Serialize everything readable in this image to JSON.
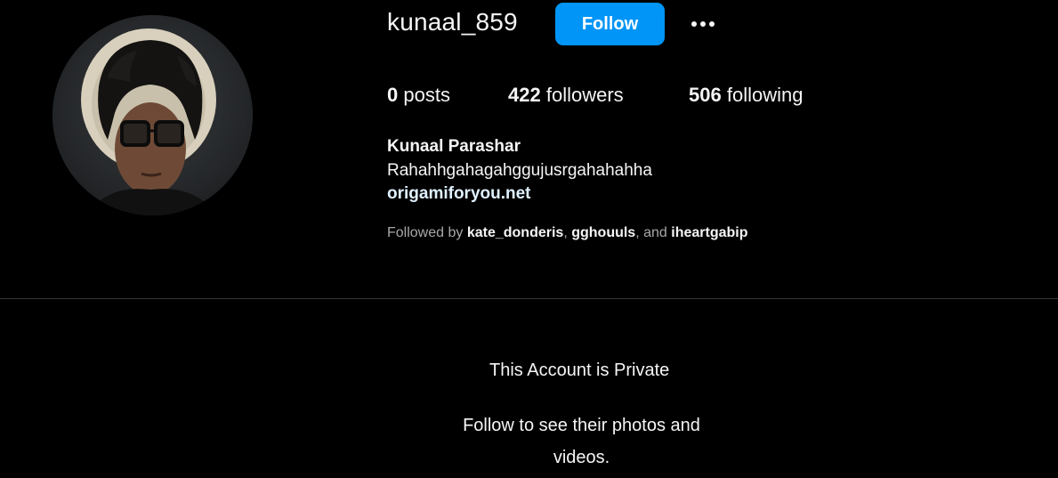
{
  "profile": {
    "username": "kunaal_859",
    "follow_label": "Follow",
    "more_label": "More options",
    "avatar_alt": "kunaal_859's profile picture"
  },
  "stats": {
    "posts_count": "0",
    "posts_label": "posts",
    "followers_count": "422",
    "followers_label": "followers",
    "following_count": "506",
    "following_label": "following"
  },
  "bio": {
    "full_name": "Kunaal Parashar",
    "text": "Rahahhgahagahggujusrgahahahha",
    "link": "origamiforyou.net"
  },
  "followed_by": {
    "prefix": "Followed by",
    "users": [
      "kate_donderis",
      "gghouuls",
      "iheartgabip"
    ],
    "separator": ",",
    "conjunction": "and"
  },
  "private": {
    "title": "This Account is Private",
    "subtitle": "Follow to see their photos and videos."
  },
  "colors": {
    "background": "#000000",
    "primary_text": "#f5f5f5",
    "secondary_text": "#a8a8a8",
    "follow_button": "#0095f6",
    "divider": "#363636"
  }
}
